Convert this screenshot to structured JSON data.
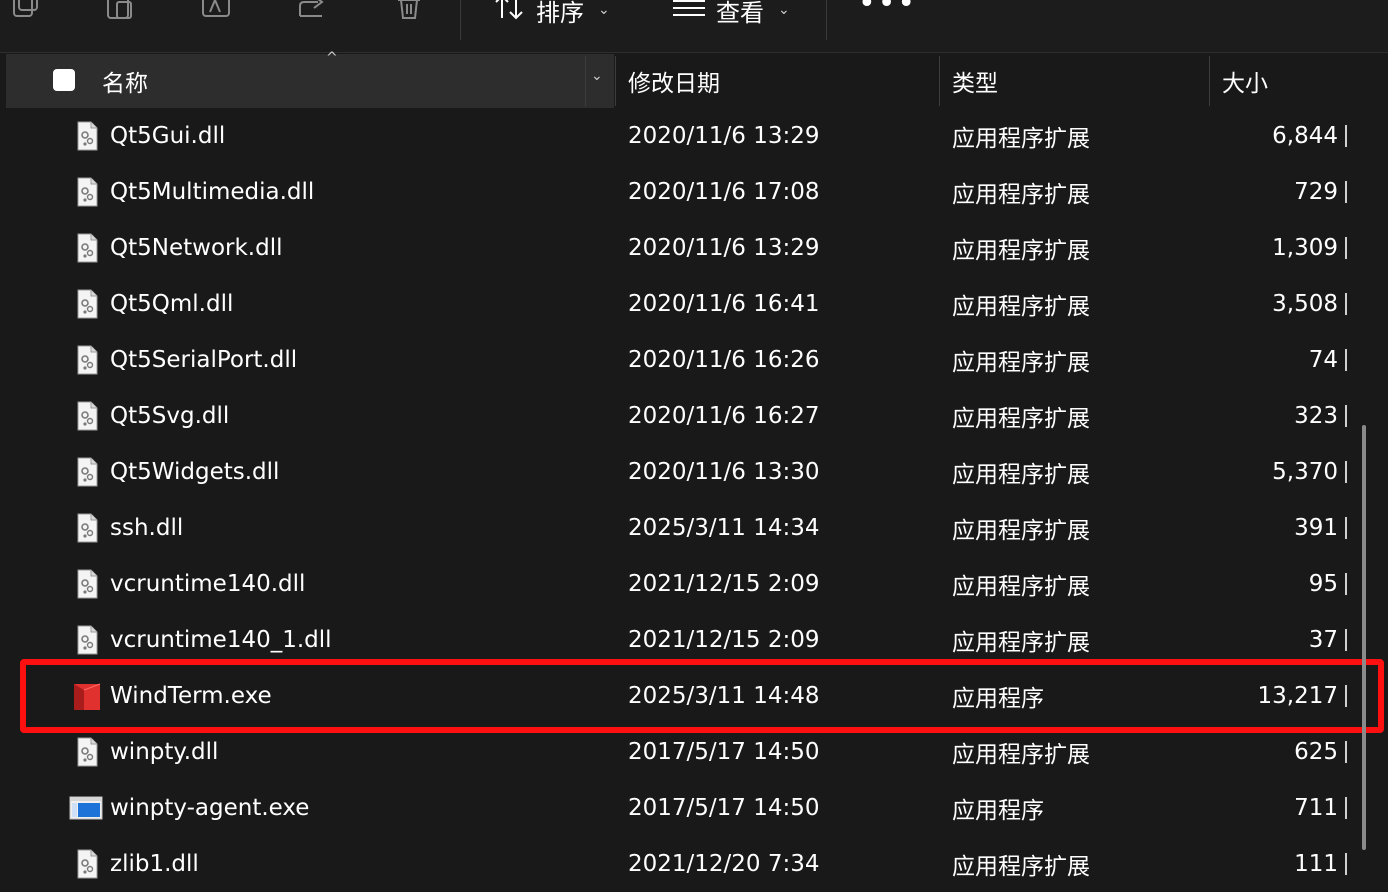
{
  "toolbar": {
    "sort_label": "排序",
    "view_label": "查看",
    "more_label": "•••"
  },
  "columns": {
    "name": "名称",
    "date": "修改日期",
    "type": "类型",
    "size": "大小"
  },
  "rows": [
    {
      "name": "Qt5Gui.dll",
      "date": "2020/11/6 13:29",
      "type": "应用程序扩展",
      "size": "6,844",
      "icon": "dll-file-icon"
    },
    {
      "name": "Qt5Multimedia.dll",
      "date": "2020/11/6 17:08",
      "type": "应用程序扩展",
      "size": "729",
      "icon": "dll-file-icon"
    },
    {
      "name": "Qt5Network.dll",
      "date": "2020/11/6 13:29",
      "type": "应用程序扩展",
      "size": "1,309",
      "icon": "dll-file-icon"
    },
    {
      "name": "Qt5Qml.dll",
      "date": "2020/11/6 16:41",
      "type": "应用程序扩展",
      "size": "3,508",
      "icon": "dll-file-icon"
    },
    {
      "name": "Qt5SerialPort.dll",
      "date": "2020/11/6 16:26",
      "type": "应用程序扩展",
      "size": "74",
      "icon": "dll-file-icon"
    },
    {
      "name": "Qt5Svg.dll",
      "date": "2020/11/6 16:27",
      "type": "应用程序扩展",
      "size": "323",
      "icon": "dll-file-icon"
    },
    {
      "name": "Qt5Widgets.dll",
      "date": "2020/11/6 13:30",
      "type": "应用程序扩展",
      "size": "5,370",
      "icon": "dll-file-icon"
    },
    {
      "name": "ssh.dll",
      "date": "2025/3/11 14:34",
      "type": "应用程序扩展",
      "size": "391",
      "icon": "dll-file-icon"
    },
    {
      "name": "vcruntime140.dll",
      "date": "2021/12/15 2:09",
      "type": "应用程序扩展",
      "size": "95",
      "icon": "dll-file-icon"
    },
    {
      "name": "vcruntime140_1.dll",
      "date": "2021/12/15 2:09",
      "type": "应用程序扩展",
      "size": "37",
      "icon": "dll-file-icon"
    },
    {
      "name": "WindTerm.exe",
      "date": "2025/3/11 14:48",
      "type": "应用程序",
      "size": "13,217",
      "icon": "windterm-app-icon"
    },
    {
      "name": "winpty.dll",
      "date": "2017/5/17 14:50",
      "type": "应用程序扩展",
      "size": "625",
      "icon": "dll-file-icon"
    },
    {
      "name": "winpty-agent.exe",
      "date": "2017/5/17 14:50",
      "type": "应用程序",
      "size": "711",
      "icon": "exe-window-icon"
    },
    {
      "name": "zlib1.dll",
      "date": "2021/12/20 7:34",
      "type": "应用程序扩展",
      "size": "111",
      "icon": "dll-file-icon"
    }
  ],
  "colors": {
    "background": "#191919",
    "header_selected": "#2d2d2d",
    "highlight_border": "#ff1010",
    "windterm_red": "#e0312f"
  }
}
